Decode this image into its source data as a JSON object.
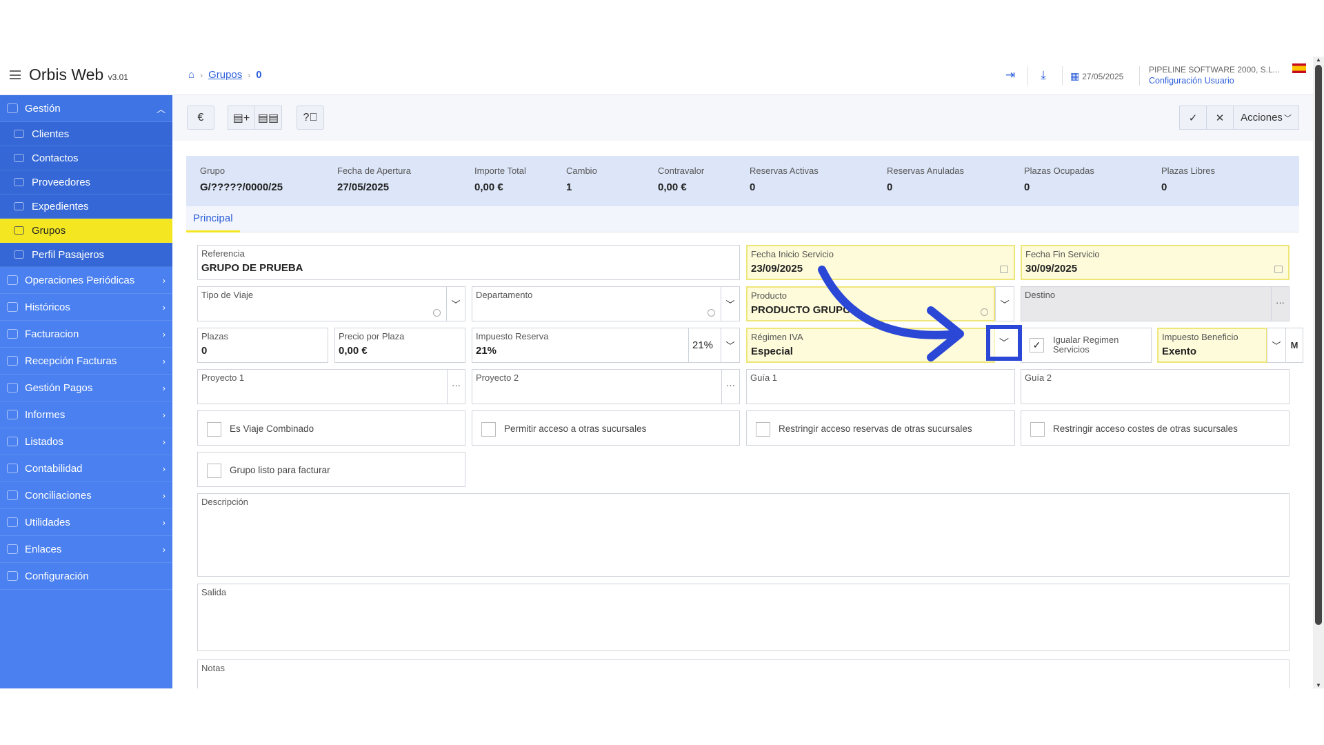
{
  "app": {
    "name": "Orbis Web",
    "version": "v3.01"
  },
  "breadcrumb": {
    "home_icon": "home-icon",
    "grupos": "Grupos",
    "current": "0"
  },
  "topbar": {
    "date": "27/05/2025",
    "company": "PIPELINE SOFTWARE 2000, S.L...",
    "config_link": "Configuración Usuario"
  },
  "sidebar": {
    "gestion": "Gestión",
    "sub_items": [
      "Clientes",
      "Contactos",
      "Proveedores",
      "Expedientes",
      "Grupos",
      "Perfil Pasajeros"
    ],
    "items": [
      "Operaciones Periódicas",
      "Históricos",
      "Facturacion",
      "Recepción Facturas",
      "Gestión Pagos",
      "Informes",
      "Listados",
      "Contabilidad",
      "Conciliaciones",
      "Utilidades",
      "Enlaces",
      "Configuración"
    ]
  },
  "toolbar": {
    "euro": "€",
    "acciones": "Acciones"
  },
  "summary": [
    {
      "label": "Grupo",
      "value": "G/?????/0000/25"
    },
    {
      "label": "Fecha de Apertura",
      "value": "27/05/2025"
    },
    {
      "label": "Importe Total",
      "value": "0,00 €"
    },
    {
      "label": "Cambio",
      "value": "1"
    },
    {
      "label": "Contravalor",
      "value": "0,00 €"
    },
    {
      "label": "Reservas Activas",
      "value": "0"
    },
    {
      "label": "Reservas Anuladas",
      "value": "0"
    },
    {
      "label": "Plazas Ocupadas",
      "value": "0"
    },
    {
      "label": "Plazas Libres",
      "value": "0"
    }
  ],
  "tabs": {
    "principal": "Principal"
  },
  "form": {
    "referencia": {
      "label": "Referencia",
      "value": "GRUPO DE PRUEBA"
    },
    "fecha_inicio": {
      "label": "Fecha Inicio Servicio",
      "value": "23/09/2025"
    },
    "fecha_fin": {
      "label": "Fecha Fin Servicio",
      "value": "30/09/2025"
    },
    "tipo_viaje": {
      "label": "Tipo de Viaje",
      "value": ""
    },
    "departamento": {
      "label": "Departamento",
      "value": ""
    },
    "producto": {
      "label": "Producto",
      "value": "PRODUCTO GRUPOS"
    },
    "destino": {
      "label": "Destino",
      "value": ""
    },
    "plazas": {
      "label": "Plazas",
      "value": "0"
    },
    "precio_plaza": {
      "label": "Precio por Plaza",
      "value": "0,00 €"
    },
    "impuesto_reserva": {
      "label": "Impuesto Reserva",
      "value": "21%",
      "rate": "21%"
    },
    "regimen_iva": {
      "label": "Régimen IVA",
      "value": "Especial"
    },
    "igualar": {
      "label": "Igualar Regimen Servicios",
      "checked": true
    },
    "impuesto_beneficio": {
      "label": "Impuesto Beneficio",
      "value": "Exento",
      "m": "M"
    },
    "proyecto1": {
      "label": "Proyecto 1",
      "value": ""
    },
    "proyecto2": {
      "label": "Proyecto 2",
      "value": ""
    },
    "guia1": {
      "label": "Guía 1",
      "value": ""
    },
    "guia2": {
      "label": "Guía 2",
      "value": ""
    },
    "checks": {
      "viaje_combinado": "Es Viaje Combinado",
      "acceso_sucursales": "Permitir acceso a otras sucursales",
      "restringir_reservas": "Restringir acceso reservas de otras sucursales",
      "restringir_costes": "Restringir acceso costes de otras sucursales",
      "listo_facturar": "Grupo listo para facturar"
    },
    "descripcion": "Descripción",
    "salida": "Salida",
    "notas": "Notas"
  },
  "colors": {
    "accent": "#2d5fd9",
    "sidebar": "#4a80ef",
    "active": "#f4e721",
    "annotation": "#2b47d6"
  }
}
